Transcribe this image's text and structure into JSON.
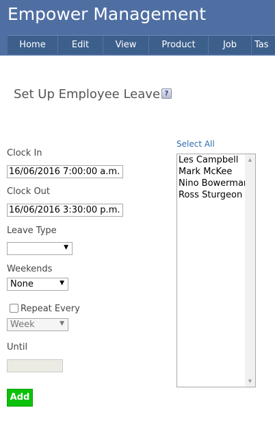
{
  "app": {
    "title": "Empower Management"
  },
  "nav": {
    "items": [
      {
        "label": "Home"
      },
      {
        "label": "Edit"
      },
      {
        "label": "View"
      },
      {
        "label": "Product"
      },
      {
        "label": "Job"
      },
      {
        "label": "Tas"
      }
    ]
  },
  "page": {
    "title": "Set Up Employee Leave",
    "help_icon": "help-question-icon"
  },
  "form": {
    "clock_in": {
      "label": "Clock In",
      "value": "16/06/2016 7:00:00 a.m."
    },
    "clock_out": {
      "label": "Clock Out",
      "value": "16/06/2016 3:30:00 p.m."
    },
    "leave_type": {
      "label": "Leave Type",
      "value": ""
    },
    "weekends": {
      "label": "Weekends",
      "value": "None"
    },
    "repeat": {
      "label": "Repeat Every",
      "checked": false,
      "value": "Week"
    },
    "until": {
      "label": "Until",
      "value": ""
    },
    "add_label": "Add"
  },
  "employees": {
    "select_all_label": "Select All",
    "items": [
      "Les Campbell",
      "Mark McKee",
      "Nino Bowerman",
      "Ross Sturgeon"
    ]
  },
  "colors": {
    "header": "#4f6fa3",
    "nav": "#3d5f8c",
    "add_button": "#0cc10c",
    "link": "#2e6bb0"
  }
}
